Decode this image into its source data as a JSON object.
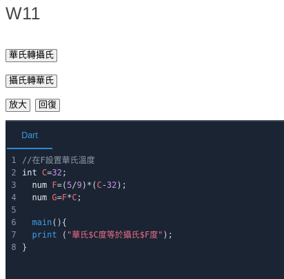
{
  "page": {
    "title": "W11"
  },
  "buttons": {
    "f_to_c": "華氏轉攝氏",
    "c_to_f": "攝氏轉華氏",
    "zoom": "放大",
    "reset": "回復"
  },
  "editor": {
    "tab": "Dart",
    "line_numbers": [
      "1",
      "2",
      "3",
      "4",
      "5",
      "6",
      "7",
      "8"
    ],
    "line1": {
      "comment": "//在F設置華氏溫度"
    },
    "line2": {
      "type": "int",
      "var": "C",
      "eq": "=",
      "num": "32",
      "end": ";"
    },
    "line3": {
      "type": "num",
      "var_f": "F",
      "eq": "=(",
      "n5": "5",
      "slash": "/",
      "n9": "9",
      "mul": ")*(",
      "var_c": "C",
      "minus": "-",
      "n32": "32",
      "end": ");"
    },
    "line4": {
      "type": "num",
      "var_g": "G",
      "eq": "=",
      "var_f": "F",
      "star": "*",
      "var_c": "C",
      "end": ";"
    },
    "line6": {
      "fn": "main",
      "rest": "(){"
    },
    "line7": {
      "fn": "print",
      "open": " (",
      "str": "\"華氏$C度等於攝氏$F度\"",
      "close": ");"
    },
    "line8": {
      "brace": "}"
    }
  },
  "colors": {
    "editor_bg": "#1b2432",
    "tab_accent": "#2b8bd8",
    "variable": "#f07178",
    "string": "#ec6d8a",
    "number": "#c792ea",
    "function": "#3aa0e8"
  }
}
